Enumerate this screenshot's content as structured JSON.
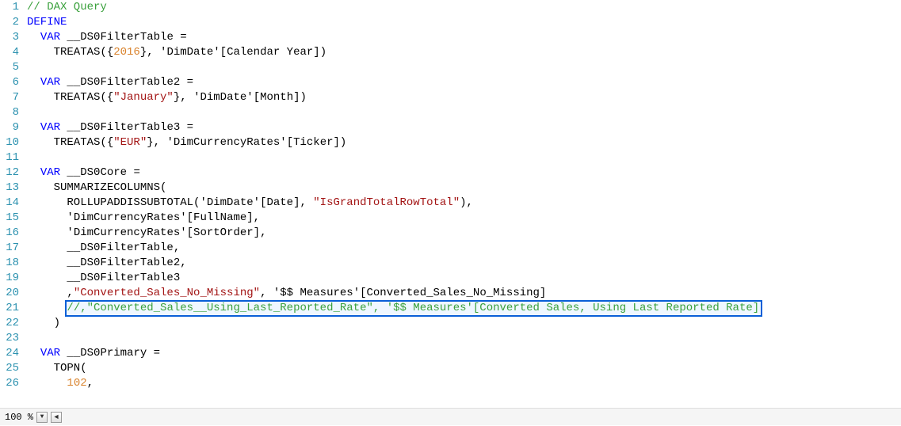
{
  "status": {
    "zoom": "100 %"
  },
  "selection": {
    "line": 21
  },
  "lines": [
    {
      "n": 1,
      "tokens": [
        {
          "t": "// DAX Query",
          "c": "c-comment"
        }
      ]
    },
    {
      "n": 2,
      "tokens": [
        {
          "t": "DEFINE",
          "c": "c-keyword"
        }
      ]
    },
    {
      "n": 3,
      "tokens": [
        {
          "t": "  ",
          "c": ""
        },
        {
          "t": "VAR",
          "c": "c-keyword"
        },
        {
          "t": " __DS0FilterTable =",
          "c": ""
        }
      ]
    },
    {
      "n": 4,
      "tokens": [
        {
          "t": "    TREATAS({",
          "c": ""
        },
        {
          "t": "2016",
          "c": "c-number"
        },
        {
          "t": "}, ",
          "c": ""
        },
        {
          "t": "'DimDate'",
          "c": ""
        },
        {
          "t": "[Calendar Year])",
          "c": ""
        }
      ]
    },
    {
      "n": 5,
      "tokens": [
        {
          "t": "",
          "c": ""
        }
      ]
    },
    {
      "n": 6,
      "tokens": [
        {
          "t": "  ",
          "c": ""
        },
        {
          "t": "VAR",
          "c": "c-keyword"
        },
        {
          "t": " __DS0FilterTable2 =",
          "c": ""
        }
      ]
    },
    {
      "n": 7,
      "tokens": [
        {
          "t": "    TREATAS({",
          "c": ""
        },
        {
          "t": "\"January\"",
          "c": "c-string"
        },
        {
          "t": "}, ",
          "c": ""
        },
        {
          "t": "'DimDate'",
          "c": ""
        },
        {
          "t": "[Month])",
          "c": ""
        }
      ]
    },
    {
      "n": 8,
      "tokens": [
        {
          "t": "",
          "c": ""
        }
      ]
    },
    {
      "n": 9,
      "tokens": [
        {
          "t": "  ",
          "c": ""
        },
        {
          "t": "VAR",
          "c": "c-keyword"
        },
        {
          "t": " __DS0FilterTable3 =",
          "c": ""
        }
      ]
    },
    {
      "n": 10,
      "tokens": [
        {
          "t": "    TREATAS({",
          "c": ""
        },
        {
          "t": "\"EUR\"",
          "c": "c-string"
        },
        {
          "t": "}, ",
          "c": ""
        },
        {
          "t": "'DimCurrencyRates'",
          "c": ""
        },
        {
          "t": "[Ticker])",
          "c": ""
        }
      ]
    },
    {
      "n": 11,
      "tokens": [
        {
          "t": "",
          "c": ""
        }
      ]
    },
    {
      "n": 12,
      "tokens": [
        {
          "t": "  ",
          "c": ""
        },
        {
          "t": "VAR",
          "c": "c-keyword"
        },
        {
          "t": " __DS0Core =",
          "c": ""
        }
      ]
    },
    {
      "n": 13,
      "tokens": [
        {
          "t": "    SUMMARIZECOLUMNS(",
          "c": ""
        }
      ]
    },
    {
      "n": 14,
      "tokens": [
        {
          "t": "      ROLLUPADDISSUBTOTAL(",
          "c": ""
        },
        {
          "t": "'DimDate'",
          "c": ""
        },
        {
          "t": "[Date], ",
          "c": ""
        },
        {
          "t": "\"IsGrandTotalRowTotal\"",
          "c": "c-string"
        },
        {
          "t": "),",
          "c": ""
        }
      ]
    },
    {
      "n": 15,
      "tokens": [
        {
          "t": "      ",
          "c": ""
        },
        {
          "t": "'DimCurrencyRates'",
          "c": ""
        },
        {
          "t": "[FullName],",
          "c": ""
        }
      ]
    },
    {
      "n": 16,
      "tokens": [
        {
          "t": "      ",
          "c": ""
        },
        {
          "t": "'DimCurrencyRates'",
          "c": ""
        },
        {
          "t": "[SortOrder],",
          "c": ""
        }
      ]
    },
    {
      "n": 17,
      "tokens": [
        {
          "t": "      __DS0FilterTable,",
          "c": ""
        }
      ]
    },
    {
      "n": 18,
      "tokens": [
        {
          "t": "      __DS0FilterTable2,",
          "c": ""
        }
      ]
    },
    {
      "n": 19,
      "tokens": [
        {
          "t": "      __DS0FilterTable3",
          "c": ""
        }
      ]
    },
    {
      "n": 20,
      "tokens": [
        {
          "t": "      ,",
          "c": ""
        },
        {
          "t": "\"Converted_Sales_No_Missing\"",
          "c": "c-string"
        },
        {
          "t": ", ",
          "c": ""
        },
        {
          "t": "'$$ Measures'",
          "c": ""
        },
        {
          "t": "[Converted_Sales_No_Missing]",
          "c": ""
        }
      ]
    },
    {
      "n": 21,
      "tokens": [
        {
          "t": "      ",
          "c": ""
        },
        {
          "t": "//,\"Converted_Sales__Using_Last_Reported_Rate\", '$$ Measures'[Converted Sales, Using Last Reported Rate]",
          "c": "c-comment"
        }
      ]
    },
    {
      "n": 22,
      "tokens": [
        {
          "t": "    )",
          "c": ""
        }
      ]
    },
    {
      "n": 23,
      "tokens": [
        {
          "t": "",
          "c": ""
        }
      ]
    },
    {
      "n": 24,
      "tokens": [
        {
          "t": "  ",
          "c": ""
        },
        {
          "t": "VAR",
          "c": "c-keyword"
        },
        {
          "t": " __DS0Primary =",
          "c": ""
        }
      ]
    },
    {
      "n": 25,
      "tokens": [
        {
          "t": "    TOPN(",
          "c": ""
        }
      ]
    },
    {
      "n": 26,
      "tokens": [
        {
          "t": "      ",
          "c": ""
        },
        {
          "t": "102",
          "c": "c-number"
        },
        {
          "t": ",",
          "c": ""
        }
      ]
    }
  ]
}
